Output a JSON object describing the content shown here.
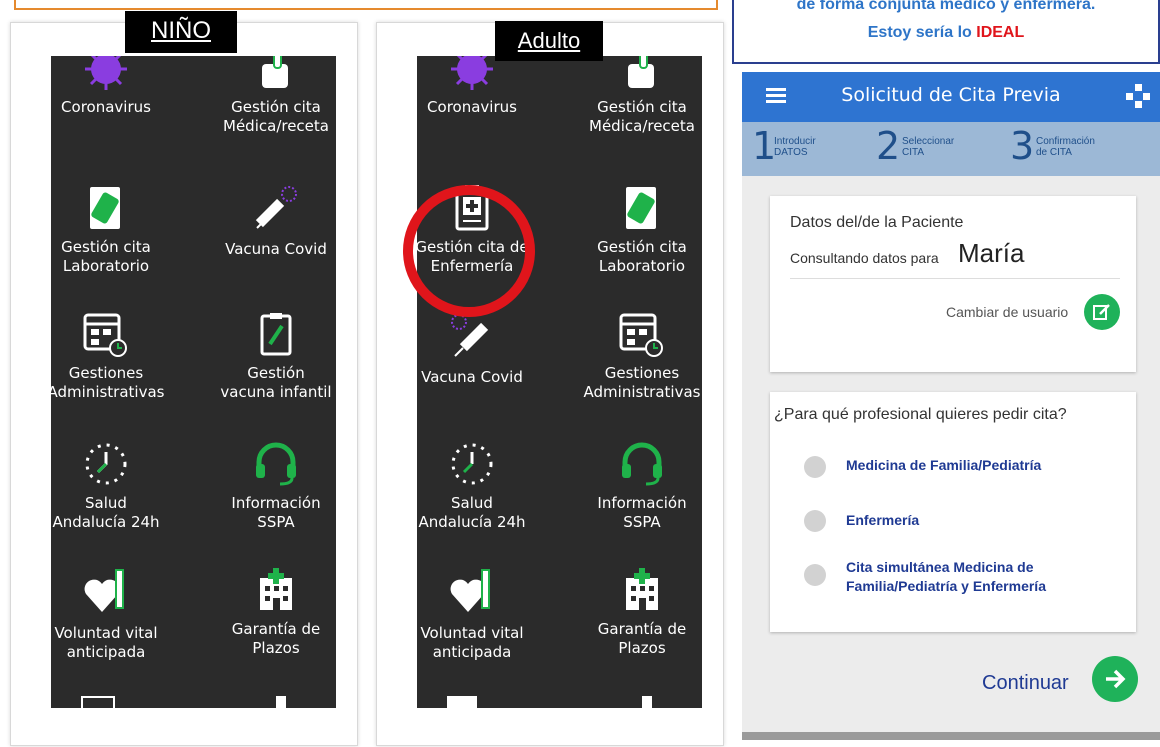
{
  "left_panel": {
    "label": "NIÑO",
    "tiles": [
      {
        "label": "Coronavirus",
        "icon": "coronavirus-icon"
      },
      {
        "label": "Gestión cita\nMédica/receta",
        "icon": "hand-icon"
      },
      {
        "label": "Gestión cita\nLaboratorio",
        "icon": "lab-document-icon"
      },
      {
        "label": "Vacuna Covid",
        "icon": "syringe-icon"
      },
      {
        "label": "Gestiones\nAdministrativas",
        "icon": "calendar-icon"
      },
      {
        "label": "Gestión\nvacuna infantil",
        "icon": "vaccine-document-icon"
      },
      {
        "label": "Salud\nAndalucía 24h",
        "icon": "clock-icon"
      },
      {
        "label": "Información\nSSPA",
        "icon": "headset-icon"
      },
      {
        "label": "Voluntad vital\nanticipada",
        "icon": "heart-pen-icon"
      },
      {
        "label": "Garantía de\nPlazos",
        "icon": "hospital-icon"
      }
    ]
  },
  "right_panel": {
    "label": "Adulto",
    "tiles": [
      {
        "label": "Coronavirus",
        "icon": "coronavirus-icon"
      },
      {
        "label": "Gestión cita\nMédica/receta",
        "icon": "hand-icon"
      },
      {
        "label": "Gestión cita de\nEnfermería",
        "icon": "nursing-clipboard-icon"
      },
      {
        "label": "Gestión cita\nLaboratorio",
        "icon": "lab-document-icon"
      },
      {
        "label": "Vacuna Covid",
        "icon": "syringe-icon"
      },
      {
        "label": "Gestiones\nAdministrativas",
        "icon": "calendar-icon"
      },
      {
        "label": "Salud\nAndalucía 24h",
        "icon": "clock-icon"
      },
      {
        "label": "Información\nSSPA",
        "icon": "headset-icon"
      },
      {
        "label": "Voluntad vital\nanticipada",
        "icon": "heart-pen-icon"
      },
      {
        "label": "Garantía de\nPlazos",
        "icon": "hospital-icon"
      }
    ]
  },
  "callout": {
    "line1": "de forma conjunta médico y enfermera.",
    "line2_prefix": "Estoy sería lo ",
    "line2_highlight": "IDEAL"
  },
  "app": {
    "title": "Solicitud de Cita Previa",
    "steps": [
      {
        "num": "1",
        "text": "Introducir\nDATOS"
      },
      {
        "num": "2",
        "text": "Seleccionar\nCITA"
      },
      {
        "num": "3",
        "text": "Confirmación\nde CITA"
      }
    ],
    "patient": {
      "heading": "Datos del/de la Paciente",
      "consulting_label": "Consultando datos para",
      "name": "María",
      "change_user": "Cambiar de usuario"
    },
    "professional": {
      "question": "¿Para qué profesional quieres pedir cita?",
      "options": [
        "Medicina de Familia/Pediatría",
        "Enfermería",
        "Cita simultánea Medicina de\nFamilia/Pediatría y Enfermería"
      ]
    },
    "continue_label": "Continuar"
  },
  "colors": {
    "accent_blue": "#2e74d1",
    "green": "#1fb25a",
    "highlight_red": "#e0151b",
    "icon_green": "#1fb24a",
    "icon_purple": "#8a3de0"
  }
}
